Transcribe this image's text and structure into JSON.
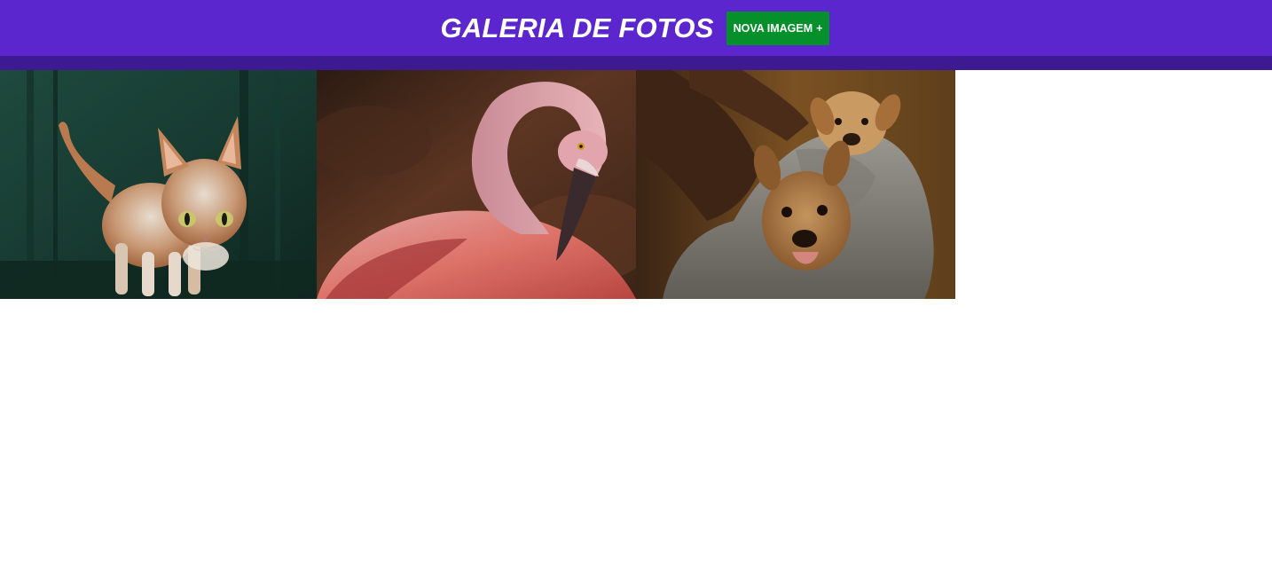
{
  "header": {
    "title": "GALERIA DE FOTOS",
    "new_image_button": {
      "label": "NOVA IMAGEM",
      "icon": "+"
    }
  },
  "gallery": {
    "images": [
      {
        "subject": "cat",
        "icon": "cat-photo"
      },
      {
        "subject": "flamingo",
        "icon": "flamingo-photo"
      },
      {
        "subject": "puppies",
        "icon": "puppies-photo"
      }
    ]
  },
  "colors": {
    "header_bg": "#5b26cd",
    "header_bar": "#3d1a92",
    "button_bg": "#06902c",
    "text": "#ffffff"
  }
}
